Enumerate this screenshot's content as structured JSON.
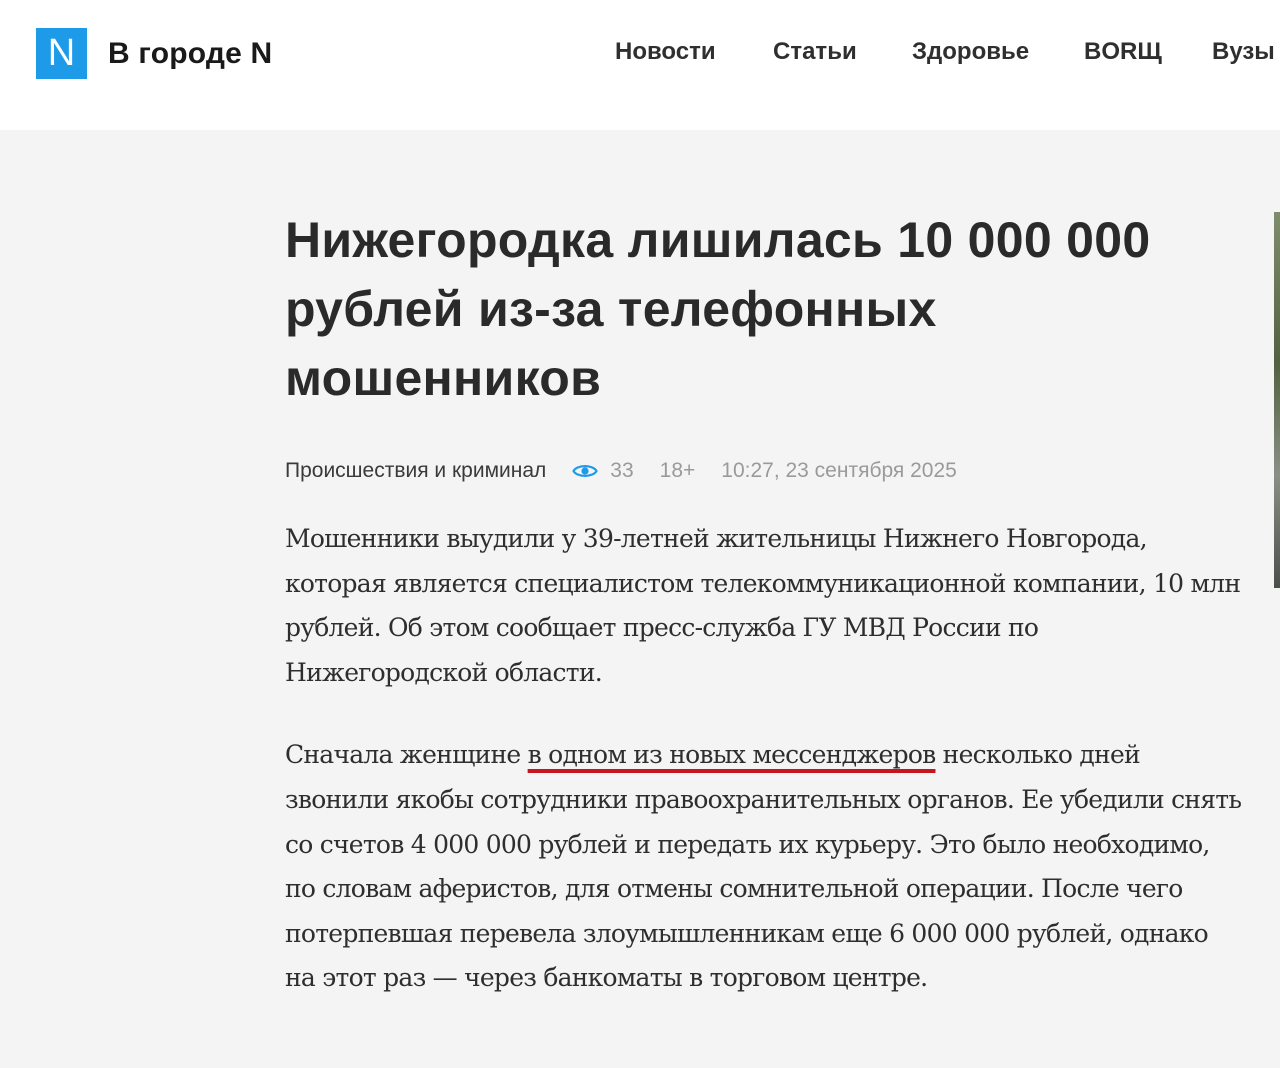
{
  "header": {
    "logo_mark": "N",
    "site_name": "В городе N",
    "nav": [
      "Новости",
      "Статьи",
      "Здоровье",
      "BORЩ",
      "Вузы"
    ]
  },
  "article": {
    "title": "Нижегородка лишилась 10 000 000 рублей из-за телефонных мошенников",
    "category": "Происшествия и криминал",
    "views": "33",
    "age_rating": "18+",
    "published": "10:27, 23 сентября 2025",
    "paragraphs": [
      {
        "before": "Мошенники выудили у 39-летней жительницы Нижнего Новгорода, которая является специалистом телекоммуникационной компании, 10 млн рублей. Об этом сообщает пресс-служба ГУ МВД России по Нижегородской области.",
        "highlight": "",
        "after": ""
      },
      {
        "before": "Сначала женщине ",
        "highlight": "в одном из новых мессенджеров",
        "after": " несколько дней звонили якобы сотрудники правоохранительных органов. Ее убедили снять со счетов 4 000 000 рублей и передать их курьеру. Это было необходимо, по словам аферистов, для отмены сомнительной операции. После чего потерпевшая перевела злоумышленникам еще 6 000 000 рублей, однако на этот раз — через банкоматы в торговом центре."
      }
    ]
  },
  "colors": {
    "logo_blue": "#1e9be8",
    "underline_red": "#c8141e",
    "eye_icon": "#1e9be8"
  },
  "icons": {
    "views": "eye-icon"
  }
}
